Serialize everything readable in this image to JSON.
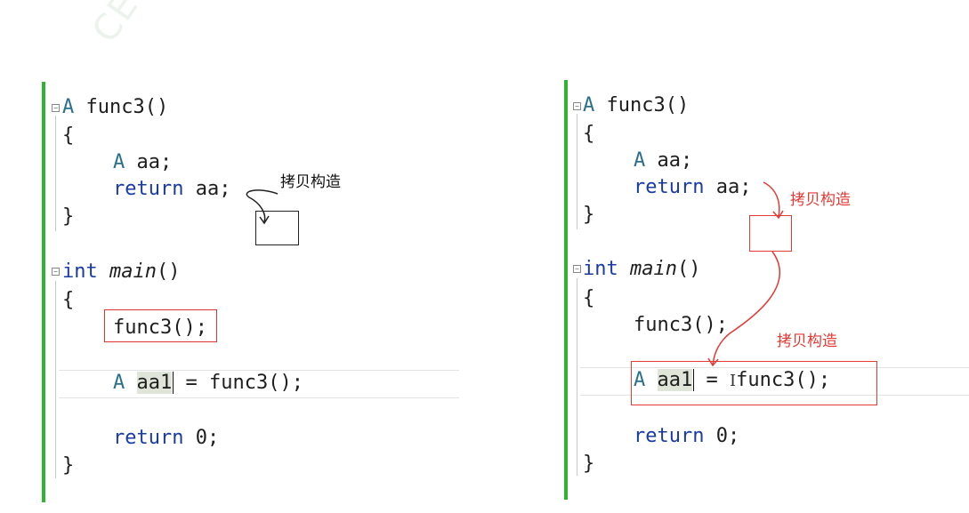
{
  "watermark": "CEUS",
  "left": {
    "lines": {
      "l1_type": "A",
      "l1_name": "func3()",
      "l2": "{",
      "l3_type": "A",
      "l3_rest": "aa;",
      "l4_kw": "return",
      "l4_rest": "aa;",
      "l5": "}",
      "l6_kw": "int",
      "l6_name": "main",
      "l6_rest": "()",
      "l7": "{",
      "l8": "func3();",
      "l9_type": "A",
      "l9_var": "aa1",
      "l9_rest": "= func3();",
      "l10_kw": "return",
      "l10_rest": "0;",
      "l11": "}"
    },
    "annotation": "拷贝构造"
  },
  "right": {
    "lines": {
      "l1_type": "A",
      "l1_name": "func3()",
      "l2": "{",
      "l3_type": "A",
      "l3_rest": "aa;",
      "l4_kw": "return",
      "l4_rest": "aa;",
      "l5": "}",
      "l6_kw": "int",
      "l6_name": "main",
      "l6_rest": "()",
      "l7": "{",
      "l8": "func3();",
      "l9_type": "A",
      "l9_var": "aa1",
      "l9_eq": "=",
      "l9_rest": "func3();",
      "l10_kw": "return",
      "l10_rest": "0;",
      "l11": "}"
    },
    "annotation_top": "拷贝构造",
    "annotation_bottom": "拷贝构造"
  },
  "colors": {
    "gutter": "#2db52d",
    "annotation_red": "#e53935",
    "annotation_black": "#111111"
  }
}
